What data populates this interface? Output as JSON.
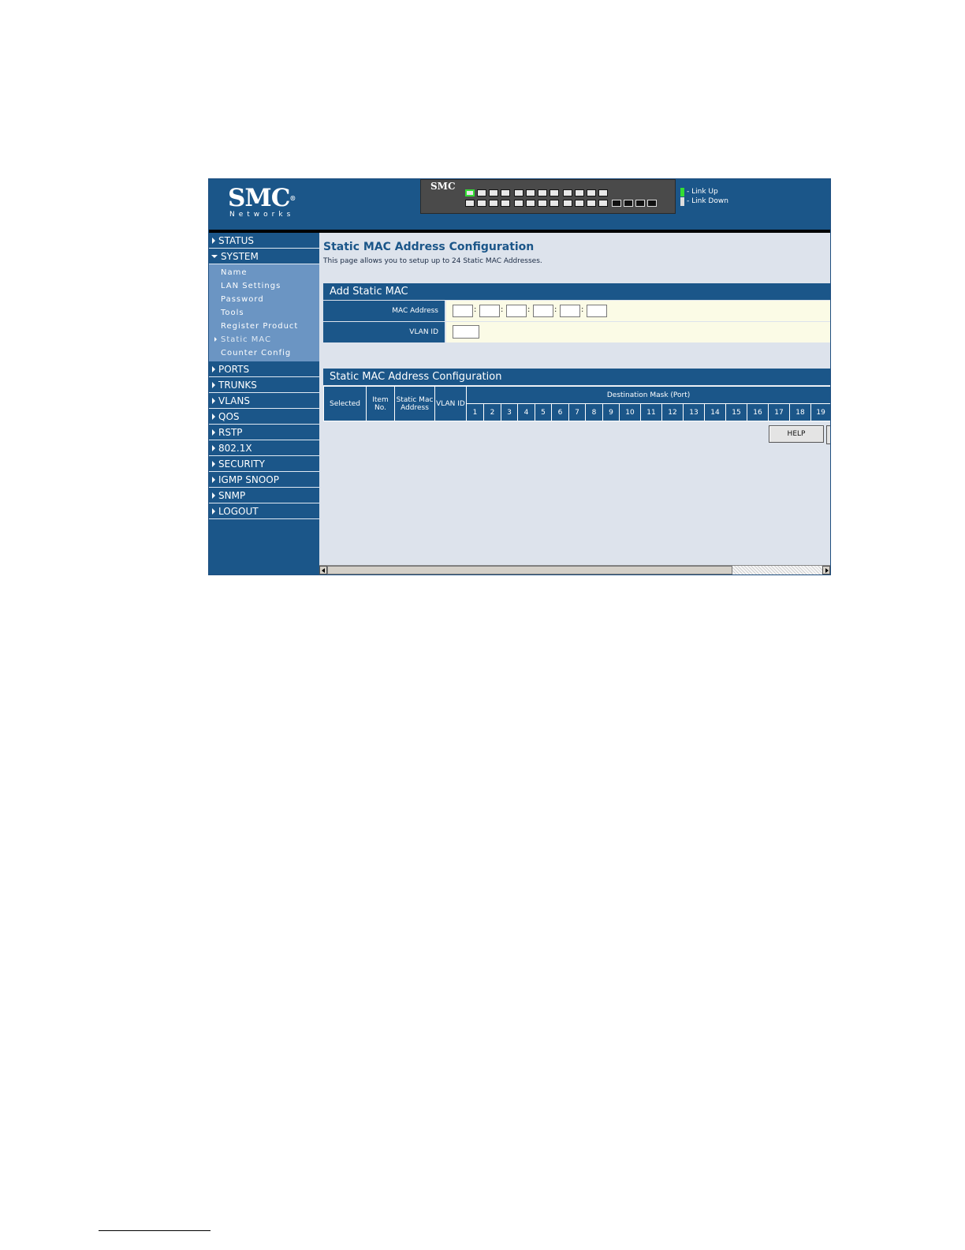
{
  "header": {
    "logo_main": "SMC",
    "logo_sub": "Networks",
    "switch_brand": "SMC",
    "legend": [
      {
        "label": "- Link Up",
        "color": "#33dd33"
      },
      {
        "label": "- Link Down",
        "color": "#dddddd"
      }
    ]
  },
  "sidebar": {
    "items": [
      {
        "label": "STATUS"
      },
      {
        "label": "SYSTEM"
      },
      {
        "label": "PORTS"
      },
      {
        "label": "TRUNKS"
      },
      {
        "label": "VLANS"
      },
      {
        "label": "QOS"
      },
      {
        "label": "RSTP"
      },
      {
        "label": "802.1X"
      },
      {
        "label": "SECURITY"
      },
      {
        "label": "IGMP SNOOP"
      },
      {
        "label": "SNMP"
      },
      {
        "label": "LOGOUT"
      }
    ],
    "system_sub": [
      {
        "label": "Name"
      },
      {
        "label": "LAN Settings"
      },
      {
        "label": "Password"
      },
      {
        "label": "Tools"
      },
      {
        "label": "Register Product"
      },
      {
        "label": "Static MAC"
      },
      {
        "label": "Counter Config"
      }
    ]
  },
  "main": {
    "title": "Static MAC Address Configuration",
    "description": "This page allows you to setup up to 24 Static MAC Addresses.",
    "add_section": {
      "heading": "Add Static MAC",
      "mac_label": "MAC Address",
      "mac_separator": ":",
      "vlan_label": "VLAN ID"
    },
    "table_section": {
      "heading": "Static MAC Address Configuration",
      "col_selected": "Selected",
      "col_item_no": "Item No.",
      "col_static_mac": "Static Mac Address",
      "col_vlan_id": "VLAN ID",
      "col_dest_mask": "Destination Mask (Port)",
      "ports": [
        "1",
        "2",
        "3",
        "4",
        "5",
        "6",
        "7",
        "8",
        "9",
        "10",
        "11",
        "12",
        "13",
        "14",
        "15",
        "16",
        "17",
        "18",
        "19"
      ]
    },
    "help_button": "HELP"
  },
  "colors": {
    "brand_blue": "#1b5689",
    "content_bg": "#dde3ec",
    "form_bg": "#fbfbe6"
  }
}
